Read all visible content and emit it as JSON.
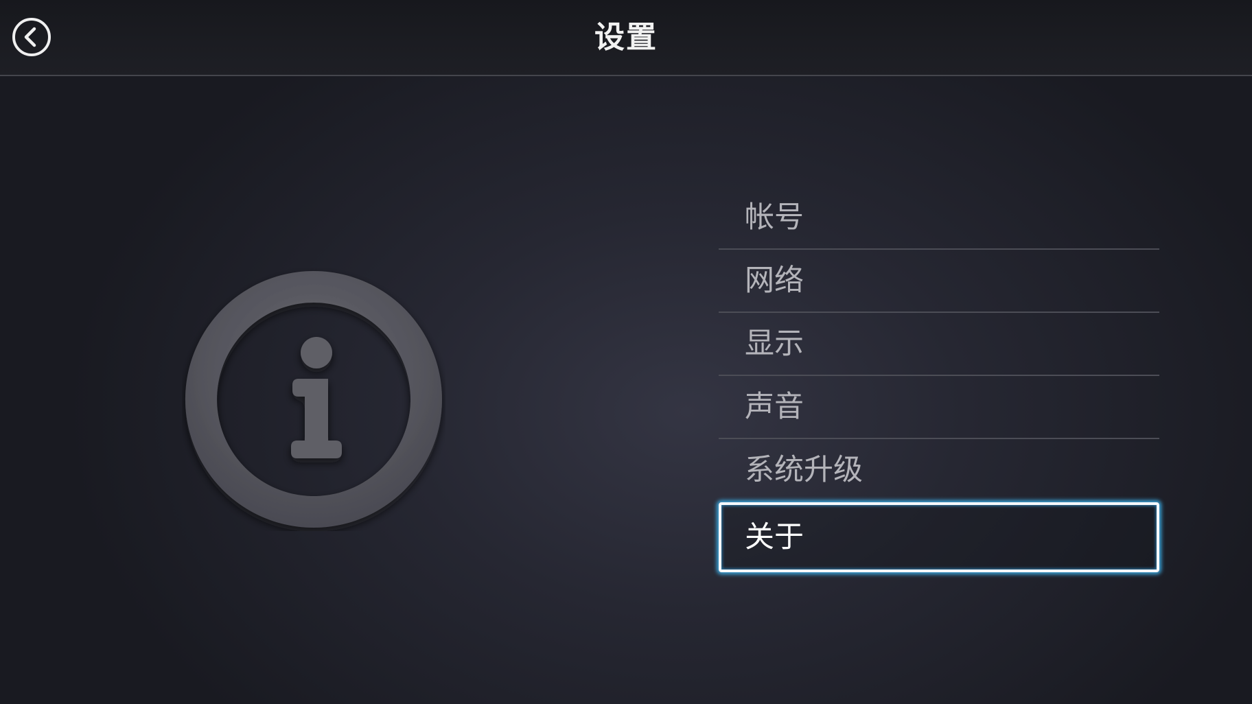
{
  "header": {
    "title": "设置",
    "back_icon": "chevron-left-circle-icon"
  },
  "graphic": {
    "icon": "info-icon"
  },
  "menu": {
    "items": [
      {
        "label": "帐号"
      },
      {
        "label": "网络"
      },
      {
        "label": "显示"
      },
      {
        "label": "声音"
      },
      {
        "label": "系统升级"
      },
      {
        "label": "关于",
        "selected": true
      }
    ]
  },
  "colors": {
    "focus_glow": "#3ba3d8",
    "title_text": "#f2f2f2",
    "item_text": "#b4b4ba"
  }
}
